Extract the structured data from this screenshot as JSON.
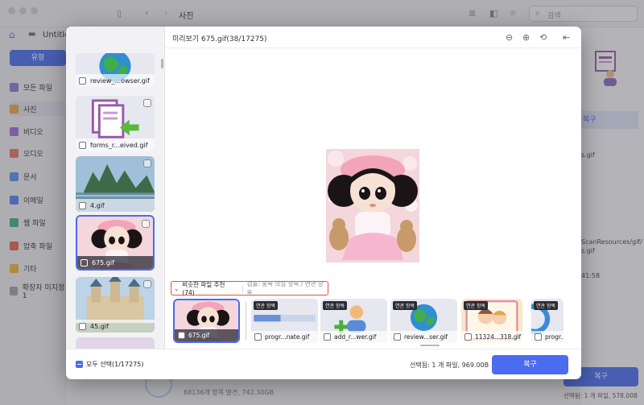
{
  "background_app": {
    "window_title": "사진",
    "drive_label": "Untitle",
    "type_button": "유형",
    "search_placeholder": "검색",
    "sidebar": [
      {
        "label": "모든 파일",
        "color": "#8a7ad6"
      },
      {
        "label": "사진",
        "color": "#e9a94a"
      },
      {
        "label": "비디오",
        "color": "#9b6ed9"
      },
      {
        "label": "오디오",
        "color": "#e8736a"
      },
      {
        "label": "문서",
        "color": "#5c8fe6"
      },
      {
        "label": "이메일",
        "color": "#5a7ff0"
      },
      {
        "label": "웹 파일",
        "color": "#3fb27b"
      },
      {
        "label": "압축 파일",
        "color": "#e2664d"
      },
      {
        "label": "기타",
        "color": "#f0b33a"
      },
      {
        "label": "확장자 미지정 1",
        "color": "#a0a0a8"
      }
    ],
    "right_panel": {
      "restore_chip": "복구",
      "filename": "s.gif",
      "path_line1": "ScanResources/gif/",
      "path_line2": "s.gif",
      "time": "41:58"
    },
    "found_text": "68136개 항목 발견, 742.30GB",
    "restore_button": "복구",
    "selection_info": "선택됨: 1 개 파일, 578.00B"
  },
  "modal": {
    "title": "미리보기 675.gif(38/17275)",
    "left_list": [
      {
        "name": "review_...owser.gif",
        "kind": "globe"
      },
      {
        "name": "forms_r...eived.gif",
        "kind": "forms"
      },
      {
        "name": "4.gif",
        "kind": "landscape"
      },
      {
        "name": "675.gif",
        "kind": "doll",
        "selected": true
      },
      {
        "name": "45.gif",
        "kind": "castle"
      },
      {
        "name": "",
        "kind": "partial"
      }
    ],
    "similar": {
      "label": "비슷한 파일 추천 (74)",
      "detect_label": "검출: 중복 의심 항목 / 연관 항목"
    },
    "strip": [
      {
        "name": "675.gif",
        "kind": "doll",
        "selected": true,
        "badge": ""
      },
      {
        "name": "progr...nate.gif",
        "kind": "progress",
        "badge": "연관 항목"
      },
      {
        "name": "add_r...wer.gif",
        "kind": "adduser",
        "badge": "연관 항목"
      },
      {
        "name": "review...ser.gif",
        "kind": "globe",
        "badge": "연관 항목"
      },
      {
        "name": "11324...318.gif",
        "kind": "cartoon",
        "badge": "연관 항목"
      },
      {
        "name": "progr...e",
        "kind": "ring",
        "badge": "연관 항목"
      }
    ],
    "footer": {
      "select_all": "모두 선택(1/17275)",
      "selection_info": "선택됨: 1 개 파일, 969.00B",
      "restore_button": "복구"
    }
  },
  "colors": {
    "accent": "#4a6cf0",
    "close": "#ec5b57",
    "highlight_border": "#e2543e"
  }
}
